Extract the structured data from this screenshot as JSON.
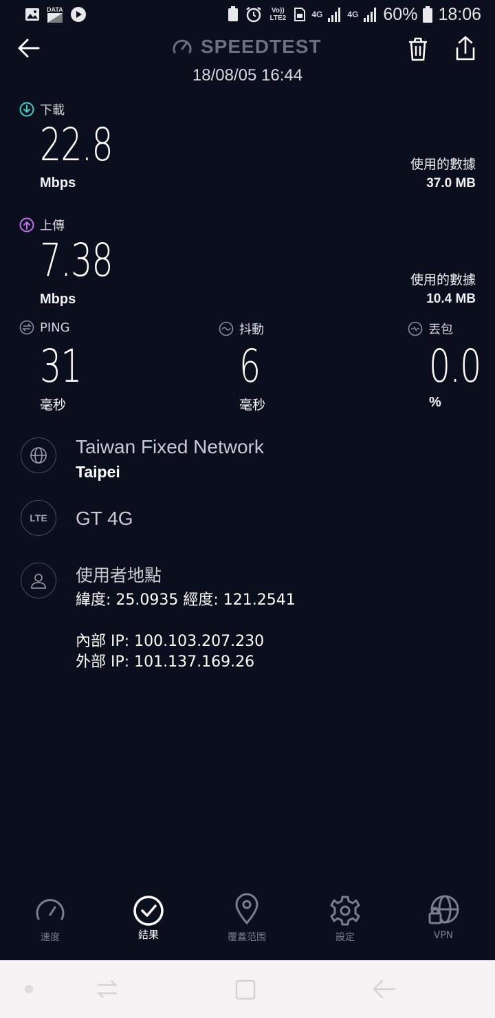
{
  "status_bar": {
    "data_label": "DATA",
    "volte_label": "Vo)) LTE2",
    "net1": "4G",
    "net2": "4G",
    "battery": "60%",
    "time": "18:06"
  },
  "header": {
    "title": "SPEEDTEST",
    "datetime": "18/08/05 16:44"
  },
  "download": {
    "label": "下載",
    "value": "22.8",
    "unit": "Mbps",
    "used_label": "使用的數據",
    "used_value": "37.0 MB"
  },
  "upload": {
    "label": "上傳",
    "value": "7.38",
    "unit": "Mbps",
    "used_label": "使用的數據",
    "used_value": "10.4 MB"
  },
  "ping": {
    "label": "PING",
    "value": "31",
    "unit": "毫秒"
  },
  "jitter": {
    "label": "抖動",
    "value": "6",
    "unit": "毫秒"
  },
  "loss": {
    "label": "丟包",
    "value": "0.0",
    "unit": "%"
  },
  "server": {
    "provider": "Taiwan Fixed Network",
    "city": "Taipei"
  },
  "connection": {
    "badge": "LTE",
    "carrier": "GT 4G"
  },
  "location": {
    "title": "使用者地點",
    "coords": "緯度: 25.0935 經度: 121.2541",
    "internal_ip": "內部 IP: 100.103.207.230",
    "external_ip": "外部 IP: 101.137.169.26"
  },
  "nav": {
    "items": [
      {
        "label": "速度",
        "icon": "speedometer-icon"
      },
      {
        "label": "結果",
        "icon": "check-circle-icon"
      },
      {
        "label": "覆蓋范围",
        "icon": "map-pin-icon"
      },
      {
        "label": "設定",
        "icon": "gear-icon"
      },
      {
        "label": "VPN",
        "icon": "vpn-globe-lock-icon"
      }
    ],
    "active": "結果"
  },
  "colors": {
    "background": "#0b0e1c",
    "download_accent": "#3fd0c7",
    "upload_accent": "#c073f0",
    "muted": "#6c6f80"
  }
}
